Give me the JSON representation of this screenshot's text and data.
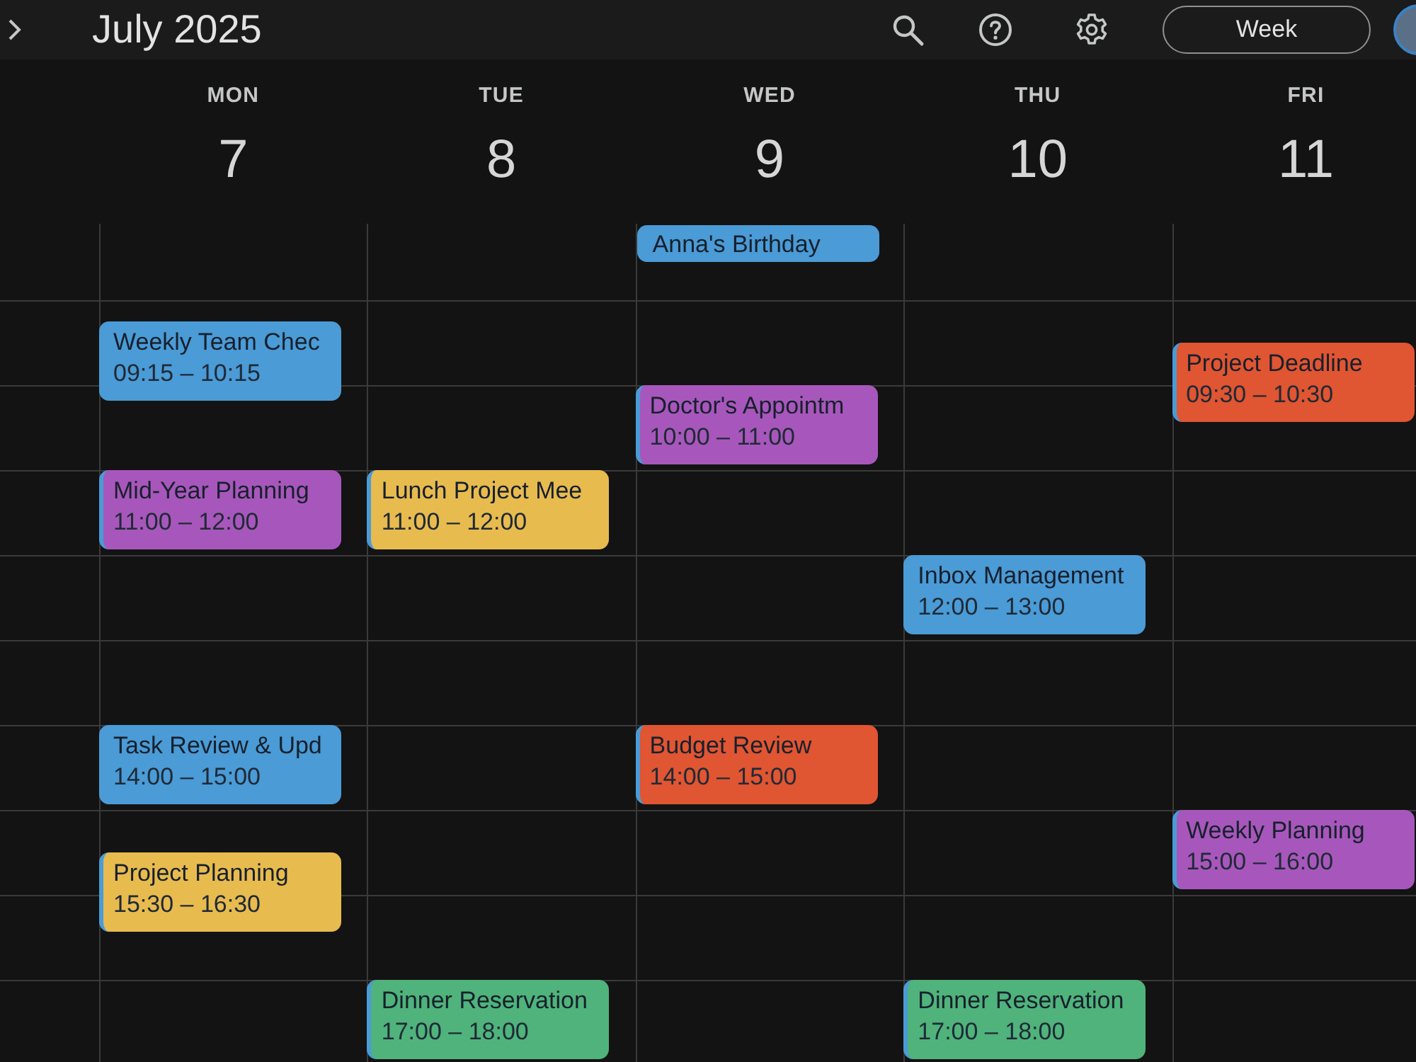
{
  "header": {
    "title": "July 2025",
    "view_button": "Week"
  },
  "days": [
    {
      "weekday": "MON",
      "date": "7",
      "events": [
        {
          "kind": "timed",
          "title": "Weekly Team Chec",
          "time": "09:15 – 10:15",
          "color": "#4a9bd6"
        },
        {
          "kind": "timed",
          "title": "Mid-Year Planning",
          "time": "11:00 – 12:00",
          "color": "#a757bb"
        },
        {
          "kind": "timed",
          "title": "Task Review & Upd",
          "time": "14:00 – 15:00",
          "color": "#4a9bd6"
        },
        {
          "kind": "timed",
          "title": "Project Planning",
          "time": "15:30 – 16:30",
          "color": "#e8bb4f"
        }
      ]
    },
    {
      "weekday": "TUE",
      "date": "8",
      "events": [
        {
          "kind": "timed",
          "title": "Lunch Project Mee",
          "time": "11:00 – 12:00",
          "color": "#e8bb4f"
        },
        {
          "kind": "timed",
          "title": "Dinner Reservation",
          "time": "17:00 – 18:00",
          "color": "#4fb37b"
        }
      ]
    },
    {
      "weekday": "WED",
      "date": "9",
      "events": [
        {
          "kind": "all_day",
          "title": "Anna's Birthday",
          "color": "#4a9bd6"
        },
        {
          "kind": "timed",
          "title": "Doctor's Appointm",
          "time": "10:00 – 11:00",
          "color": "#a757bb"
        },
        {
          "kind": "timed",
          "title": "Budget Review",
          "time": "14:00 – 15:00",
          "color": "#e05532"
        }
      ]
    },
    {
      "weekday": "THU",
      "date": "10",
      "events": [
        {
          "kind": "timed",
          "title": "Inbox Management",
          "time": "12:00 – 13:00",
          "color": "#4a9bd6"
        },
        {
          "kind": "timed",
          "title": "Dinner Reservation",
          "time": "17:00 – 18:00",
          "color": "#4fb37b"
        }
      ]
    },
    {
      "weekday": "FRI",
      "date": "11",
      "events": [
        {
          "kind": "timed",
          "title": "Project Deadline",
          "time": "09:30 – 10:30",
          "color": "#e05532"
        },
        {
          "kind": "timed",
          "title": "Weekly Planning",
          "time": "15:00 – 16:00",
          "color": "#a757bb"
        }
      ]
    }
  ]
}
